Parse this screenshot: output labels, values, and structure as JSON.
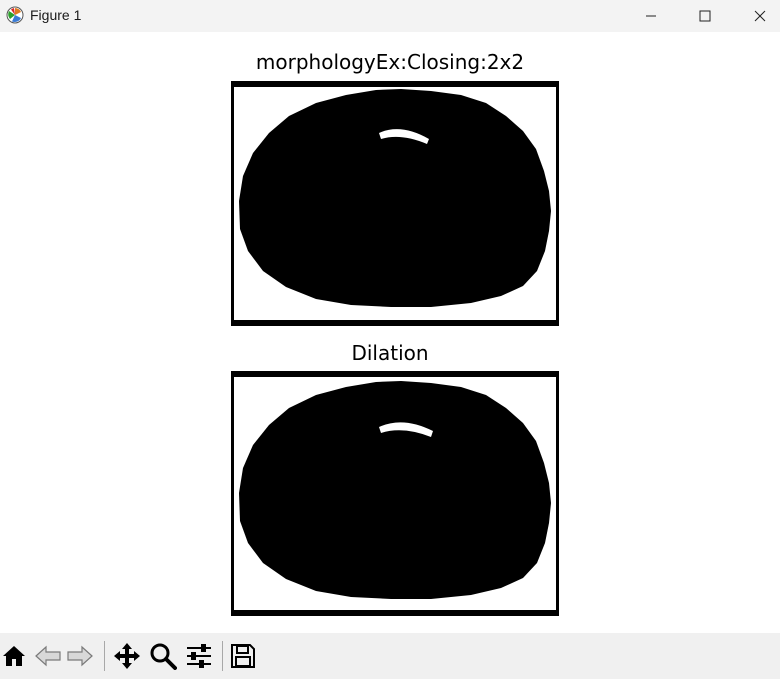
{
  "window": {
    "title": "Figure 1",
    "controls": [
      "minimize",
      "maximize",
      "close"
    ]
  },
  "figure": {
    "panels": [
      {
        "title": "morphologyEx:Closing:2x2",
        "content": "binary-image-blob"
      },
      {
        "title": "Dilation",
        "content": "binary-image-blob"
      }
    ]
  },
  "toolbar": {
    "buttons": [
      {
        "icon": "home-icon"
      },
      {
        "icon": "back-arrow-icon"
      },
      {
        "icon": "forward-arrow-icon"
      },
      {
        "icon": "pan-icon"
      },
      {
        "icon": "zoom-icon"
      },
      {
        "icon": "configure-subplots-icon"
      },
      {
        "icon": "save-icon"
      }
    ]
  }
}
